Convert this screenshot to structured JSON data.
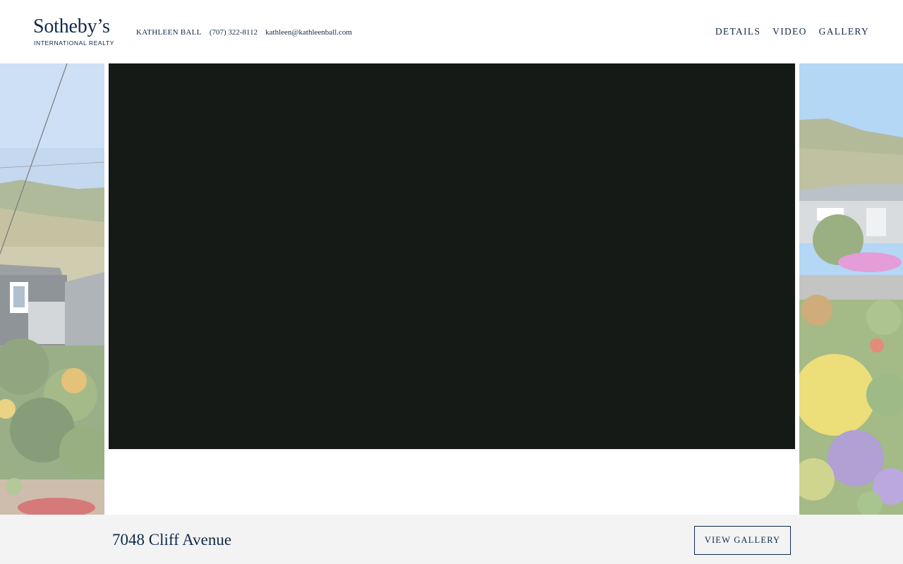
{
  "brand": {
    "name": "Sotheby’s",
    "subtitle": "INTERNATIONAL REALTY"
  },
  "agent": {
    "name": "KATHLEEN BALL",
    "phone": "(707) 322-8112",
    "email": "kathleen@kathleenball.com"
  },
  "nav": {
    "items": [
      {
        "label": "DETAILS"
      },
      {
        "label": "VIDEO"
      },
      {
        "label": "GALLERY"
      }
    ]
  },
  "listing": {
    "address": "7048 Cliff Avenue",
    "view_gallery_label": "VIEW GALLERY"
  },
  "colors": {
    "brand_navy": "#0f2a4a",
    "video_bg": "#161a17",
    "footer_bg": "#f3f3f3"
  }
}
